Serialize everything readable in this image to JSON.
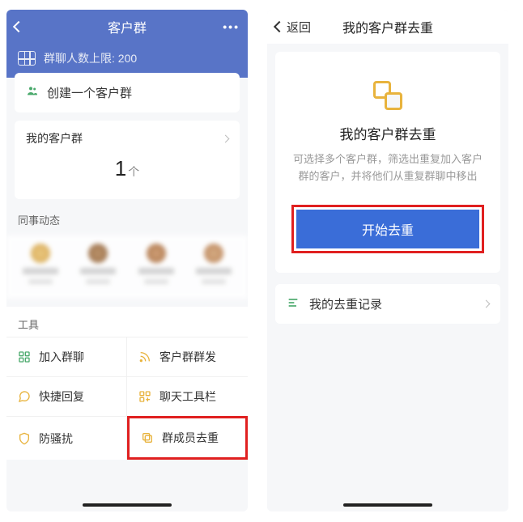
{
  "left": {
    "title": "客户群",
    "more": "•••",
    "limit": "群聊人数上限: 200",
    "create_label": "创建一个客户群",
    "my_group_label": "我的客户群",
    "count": "1",
    "count_unit": "个",
    "colleague_label": "同事动态",
    "tools_label": "工具",
    "tools": [
      {
        "label": "加入群聊",
        "color": "#4aa96c"
      },
      {
        "label": "客户群群发",
        "color": "#e8b33d"
      },
      {
        "label": "快捷回复",
        "color": "#e8b33d"
      },
      {
        "label": "聊天工具栏",
        "color": "#e8b33d"
      },
      {
        "label": "防骚扰",
        "color": "#e8b33d"
      },
      {
        "label": "群成员去重",
        "color": "#e8b33d"
      }
    ]
  },
  "right": {
    "back": "返回",
    "title": "我的客户群去重",
    "card_title": "我的客户群去重",
    "card_desc": "可选择多个客户群，筛选出重复加入客户群的客户，并将他们从重复群聊中移出",
    "start_btn": "开始去重",
    "record_label": "我的去重记录"
  }
}
